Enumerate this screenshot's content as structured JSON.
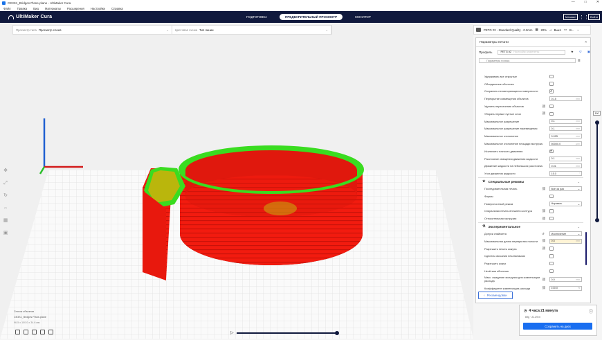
{
  "window": {
    "title": "CE3S1_Bridges Plane-plane - UltiMaker Cura",
    "controls": [
      "—",
      "□",
      "✕"
    ]
  },
  "menu": [
    "Файл",
    "Правка",
    "Вид",
    "Материалы",
    "Расширения",
    "Настройки",
    "Справка"
  ],
  "topbar": {
    "logo": "UltiMaker Cura",
    "stages": [
      "ПОДГОТОВКА",
      "ПРЕДВАРИТЕЛЬНЫЙ ПРОСМОТР",
      "МОНИТОР"
    ],
    "active_stage": 1,
    "marketplace": "Магазин",
    "signin": "Войти"
  },
  "viewbar": {
    "view_type_label": "Просмотр типа",
    "view_type_value": "Просмотр слоев",
    "color_scheme_label": "Цветовая схема",
    "color_scheme_value": "Тип линии"
  },
  "printer": {
    "profile": "PETG #2 - Standard Quality - 0.2mm",
    "infill": "20%",
    "support": "Выкл",
    "adhesion": "В..."
  },
  "settings": {
    "header": "Параметры печати",
    "close": "×",
    "profile_label": "Профиль",
    "profile_value": "PETG #2",
    "profile_hint": "Настройки изменены",
    "search_placeholder": "Параметры поиска",
    "rows": [
      {
        "label": "Удерживать все открытые",
        "type": "check",
        "checked": false,
        "link": false
      },
      {
        "label": "Объединение оболочек",
        "type": "check",
        "checked": false,
        "link": false
      },
      {
        "label": "Сохранять неповторяющиеся поверхности",
        "type": "check",
        "checked": true,
        "link": false
      },
      {
        "label": "Перекрытие совмещения объектов",
        "type": "num",
        "value": "0.15",
        "unit": "mm",
        "link": false
      },
      {
        "label": "Удалить пересечения объектов",
        "type": "check",
        "checked": false,
        "link": true
      },
      {
        "label": "Убирать первые пустые слои",
        "type": "check",
        "checked": false,
        "link": true
      },
      {
        "label": "Максимальное разрешение",
        "type": "num",
        "value": "0.1",
        "unit": "mm",
        "link": false
      },
      {
        "label": "Максимальное разрешение перемещения",
        "type": "num",
        "value": "0.1",
        "unit": "mm",
        "link": false
      },
      {
        "label": "Максимальное отклонение",
        "type": "num",
        "value": "0.025",
        "unit": "mm",
        "link": false
      },
      {
        "label": "Максимальное отклонение площади экструзии",
        "type": "num",
        "value": "50000.0",
        "unit": "µm²",
        "link": false
      },
      {
        "label": "Исключить точность движения",
        "type": "check",
        "checked": true,
        "link": false
      },
      {
        "label": "Расстояние смещения движения жидкости",
        "type": "num",
        "value": "0.1",
        "unit": "mm",
        "link": false
      },
      {
        "label": "Движение жидкости на небольшом расстоянии",
        "type": "num",
        "value": "0.01",
        "unit": "mm",
        "link": false
      },
      {
        "label": "Угол движения жидкости",
        "type": "num",
        "value": "15.0",
        "unit": "°",
        "link": false
      }
    ],
    "special_section": "Специальные режимы",
    "special_rows": [
      {
        "label": "Последовательная печать",
        "type": "sel",
        "value": "Все за раз",
        "link": true
      },
      {
        "label": "Формы",
        "type": "check",
        "checked": false,
        "link": false
      },
      {
        "label": "Поверхностный режим",
        "type": "sel",
        "value": "Нормаль",
        "link": false
      },
      {
        "label": "Спиральная печать внешнего контура",
        "type": "check",
        "checked": false,
        "link": true
      },
      {
        "label": "Относительная экструзия",
        "type": "check",
        "checked": false,
        "link": true
      }
    ],
    "exp_section": "Экспериментальное",
    "exp_rows": [
      {
        "label": "Допуск слайсинга",
        "type": "sel",
        "value": "Исключение",
        "link": true,
        "reset": true
      },
      {
        "label": "Максимальная длина перекрытия полости",
        "type": "num",
        "value": "0.5",
        "unit": "mm",
        "link": true,
        "hl": true
      },
      {
        "label": "Разрешить печать кожуха",
        "type": "check",
        "checked": false,
        "link": true
      },
      {
        "label": "Сделать свисания печатаемыми",
        "type": "check",
        "checked": false,
        "link": false
      },
      {
        "label": "Разрешить кожух",
        "type": "check",
        "checked": false,
        "link": false
      },
      {
        "label": "Нечёткая оболочка",
        "type": "check",
        "checked": false,
        "link": false
      },
      {
        "label": "Макс. ожидание экструзии для компенсации расхода",
        "type": "num",
        "value": "0.0",
        "unit": "mm",
        "link": true,
        "two": true
      },
      {
        "label": "Коэффициент компенсации расхода",
        "type": "num",
        "value": "100.0",
        "unit": "%",
        "link": true
      }
    ],
    "recommended": "Рекомендован"
  },
  "layer": {
    "current": "190",
    "level": 1.0
  },
  "objects": {
    "header": "Список объектов",
    "name": "CE3S1_Bridges Plane-plane",
    "dims": "96.5 x 100.0 x 34.6 мм"
  },
  "sim_progress": 1.0,
  "print": {
    "time": "4 часа 21 минута",
    "material": "69g · 21.29 m",
    "save": "Сохранить на диск"
  },
  "colors": {
    "model_red": "#f21b0f",
    "model_green": "#3adc20",
    "axis_x": "#d21b1b",
    "axis_y": "#2bbf2b",
    "axis_z": "#1f5fd1",
    "top_bar": "#10193d",
    "primary": "#196ef0"
  }
}
